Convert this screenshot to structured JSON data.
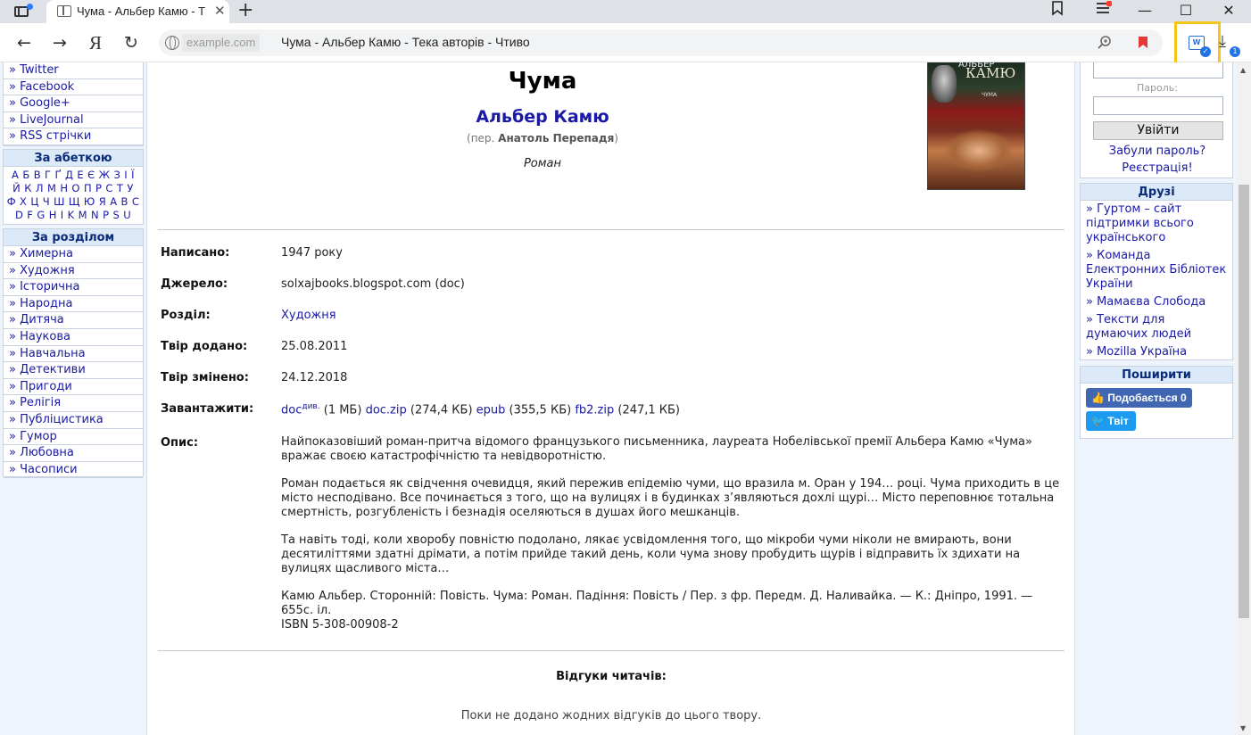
{
  "browser": {
    "tab_title": "Чума - Альбер Камю - Т",
    "tab_close": "✕",
    "new_tab": "+",
    "host": "example.com",
    "page_title": "Чума - Альбер Камю - Тека авторів - Чтиво",
    "yandex": "Я",
    "back_glyph": "←",
    "forward_glyph": "→",
    "reload_glyph": "↻",
    "minimize": "—",
    "maximize": "☐",
    "close": "✕",
    "download_badge": "1",
    "ext_label": "W"
  },
  "left": {
    "social": [
      "» Twitter",
      "» Facebook",
      "» Google+",
      "» LiveJournal",
      "» RSS стрічки"
    ],
    "alphabet_title": "За абеткою",
    "alphabet_lines": [
      "А Б В Г Ґ Д Е Є Ж З І Ї",
      "Й К Л М Н О П Р С Т У",
      "Ф Х Ц Ч Ш Щ Ю Я A B C",
      "D F G H I K M N P S U"
    ],
    "sections_title": "За розділом",
    "sections": [
      "» Химерна",
      "» Художня",
      "» Історична",
      "» Народна",
      "» Дитяча",
      "» Наукова",
      "» Навчальна",
      "» Детективи",
      "» Пригоди",
      "» Релігія",
      "» Публіцистика",
      "» Гумор",
      "» Любовна",
      "» Часописи"
    ]
  },
  "book": {
    "title": "Чума",
    "author": "Альбер Камю",
    "translator_prefix": "(пер. ",
    "translator": "Анатоль Перепадя",
    "translator_suffix": ")",
    "genre": "Роман",
    "cover": {
      "author": "АЛЬБЕР",
      "name": "КАМЮ",
      "title": "ЧУМА"
    }
  },
  "details": {
    "written_label": "Написано:",
    "written": "1947 року",
    "source_label": "Джерело:",
    "source": "solxajbooks.blogspot.com (doc)",
    "section_label": "Розділ:",
    "section": "Художня",
    "added_label": "Твір додано:",
    "added": "25.08.2011",
    "changed_label": "Твір змінено:",
    "changed": "24.12.2018",
    "download_label": "Завантажити:",
    "downloads": {
      "doc": "doc",
      "doc_sup": "див.",
      "doc_size": " (1 МБ) ",
      "doczip": "doc.zip",
      "doczip_size": " (274,4 КБ) ",
      "epub": "epub",
      "epub_size": " (355,5 КБ) ",
      "fb2": "fb2.zip",
      "fb2_size": " (247,1 КБ)"
    },
    "description_label": "Опис:",
    "description": [
      "Найпоказовіший роман-притча відомого французького письменника, лауреата Нобелівської премії Альбера Камю «Чума» вражає своєю катастрофічністю та невідворотністю.",
      "Роман подається як свідчення очевидця, який пережив епідемію чуми, що вразила м. Оран у 194… році. Чума приходить в це місто несподівано. Все починається з того, що на вулицях і в будинках з’являються дохлі щурі… Місто переповнює тотальна смертність, розгубленість і безнадія оселяються в душах його мешканців.",
      "Та навіть тоді, коли хворобу повністю подолано, лякає усвідомлення того, що мікроби чуми ніколи не вмирають, вони десятиліттями здатні дрімати, а потім прийде такий день, коли чума знову пробудить щурів і відправить їх здихати на вулицях щасливого міста…"
    ],
    "biblio_line1": "Камю Альбер. Сторонній: Повість. Чума: Роман. Падіння: Повість / Пер. з фр. Передм. Д. Наливайка. — К.: Дніпро, 1991. — 655с. іл.",
    "biblio_line2": "ISBN 5-308-00908-2"
  },
  "reviews": {
    "title": "Відгуки читачів:",
    "empty": "Поки не додано жодних відгуків до цього твору."
  },
  "right": {
    "password_label": "Пароль:",
    "login_button": "Увійти",
    "forgot": "Забули пароль?",
    "register": "Реєстрація!",
    "friends_title": "Друзі",
    "friends": [
      "» Гуртом – сайт підтримки всього українського",
      "» Команда Електронних Бібліотек України",
      "» Мамаєва Слобода",
      "» Тексти для думаючих людей",
      "» Mozilla Україна"
    ],
    "share_title": "Поширити",
    "like_button": "Подобається 0",
    "tweet_button": "Твіт"
  },
  "colors": {
    "link": "#1a1aa6",
    "sidebar_bg": "#eef4fb",
    "box_head": "#dbe9f8",
    "highlight": "#f5c518"
  }
}
